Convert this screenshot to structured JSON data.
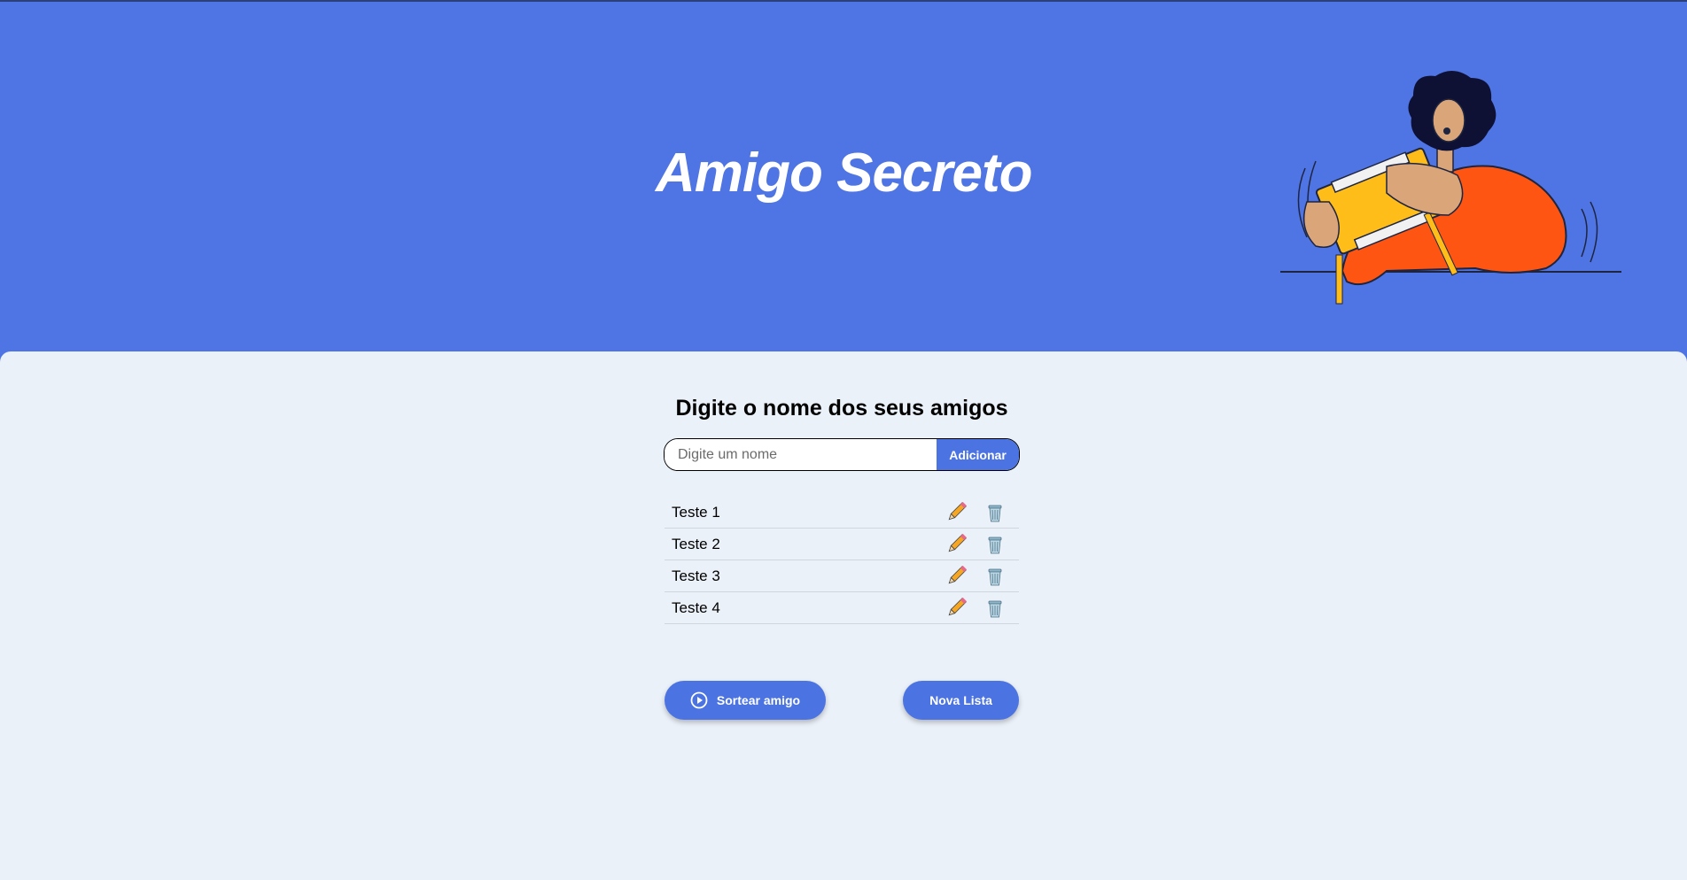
{
  "header": {
    "title": "Amigo Secreto"
  },
  "main": {
    "heading": "Digite o nome dos seus amigos",
    "input": {
      "placeholder": "Digite um nome",
      "value": ""
    },
    "add_button_label": "Adicionar",
    "friends": [
      {
        "name": "Teste 1"
      },
      {
        "name": "Teste 2"
      },
      {
        "name": "Teste 3"
      },
      {
        "name": "Teste 4"
      }
    ],
    "draw_button_label": "Sortear amigo",
    "new_list_button_label": "Nova Lista"
  },
  "icons": {
    "edit": "pencil-icon",
    "delete": "trash-icon",
    "draw": "play-circle-icon"
  },
  "colors": {
    "header_bg": "#4f74e3",
    "main_bg": "#ebf1f9",
    "accent": "#4b73e2"
  }
}
